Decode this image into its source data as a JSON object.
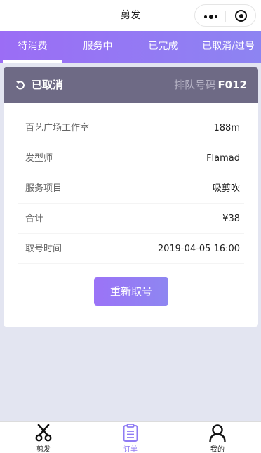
{
  "navbar": {
    "title": "剪发"
  },
  "tabs": [
    {
      "label": "待消费",
      "active": true
    },
    {
      "label": "服务中",
      "active": false
    },
    {
      "label": "已完成",
      "active": false
    },
    {
      "label": "已取消/过号",
      "active": false
    }
  ],
  "order": {
    "status": "已取消",
    "queue_label": "排队号码",
    "queue_number": "F012",
    "rows": [
      {
        "key": "百艺广场工作室",
        "value": "188m"
      },
      {
        "key": "发型师",
        "value": "Flamad"
      },
      {
        "key": "服务项目",
        "value": "吸剪吹"
      },
      {
        "key": "合计",
        "value": "¥38"
      },
      {
        "key": "取号时间",
        "value": "2019-04-05 16:00"
      }
    ],
    "rebook_label": "重新取号"
  },
  "tabbar": {
    "items": [
      {
        "label": "剪发",
        "icon": "scissors-icon"
      },
      {
        "label": "订单",
        "icon": "clipboard-icon",
        "active": true
      },
      {
        "label": "我的",
        "icon": "user-icon"
      }
    ]
  },
  "colors": {
    "accent": "#9b6df5",
    "header": "#6e6a85",
    "background": "#e3e5f1"
  }
}
